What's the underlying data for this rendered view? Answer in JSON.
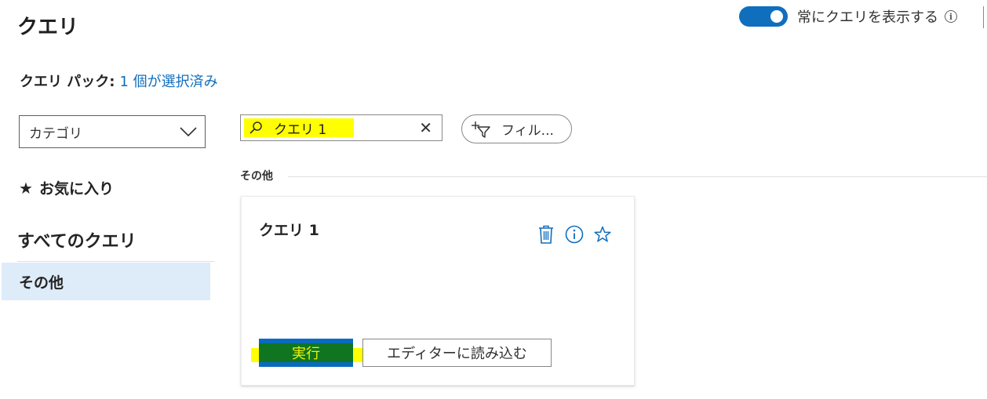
{
  "header": {
    "title": "クエリ",
    "toggle_label": "常にクエリを表示する",
    "toggle_on": true,
    "info_glyph": "i"
  },
  "query_pack": {
    "label": "クエリ パック:",
    "selected_link": "1 個が選択済み"
  },
  "sidebar": {
    "category_select": {
      "value": "カテゴリ"
    },
    "favorites_label": "お気に入り",
    "favorites_star": "★",
    "all_queries_heading": "すべてのクエリ",
    "items": [
      {
        "label": "その他",
        "selected": true
      }
    ]
  },
  "search": {
    "value": "クエリ 1",
    "clear_glyph": "✕",
    "highlight_color": "#ffff00"
  },
  "filter": {
    "label": "フィル..."
  },
  "group": {
    "label": "その他"
  },
  "card": {
    "title": "クエリ 1",
    "actions": [
      "trash-icon",
      "info-icon",
      "star-outline-icon"
    ],
    "run_label": "実行",
    "load_label": "エディターに読み込む"
  },
  "colors": {
    "accent": "#106ebe",
    "selected_bg": "#deecf9",
    "run_fill": "#0f7520",
    "run_text": "#f2f200"
  }
}
